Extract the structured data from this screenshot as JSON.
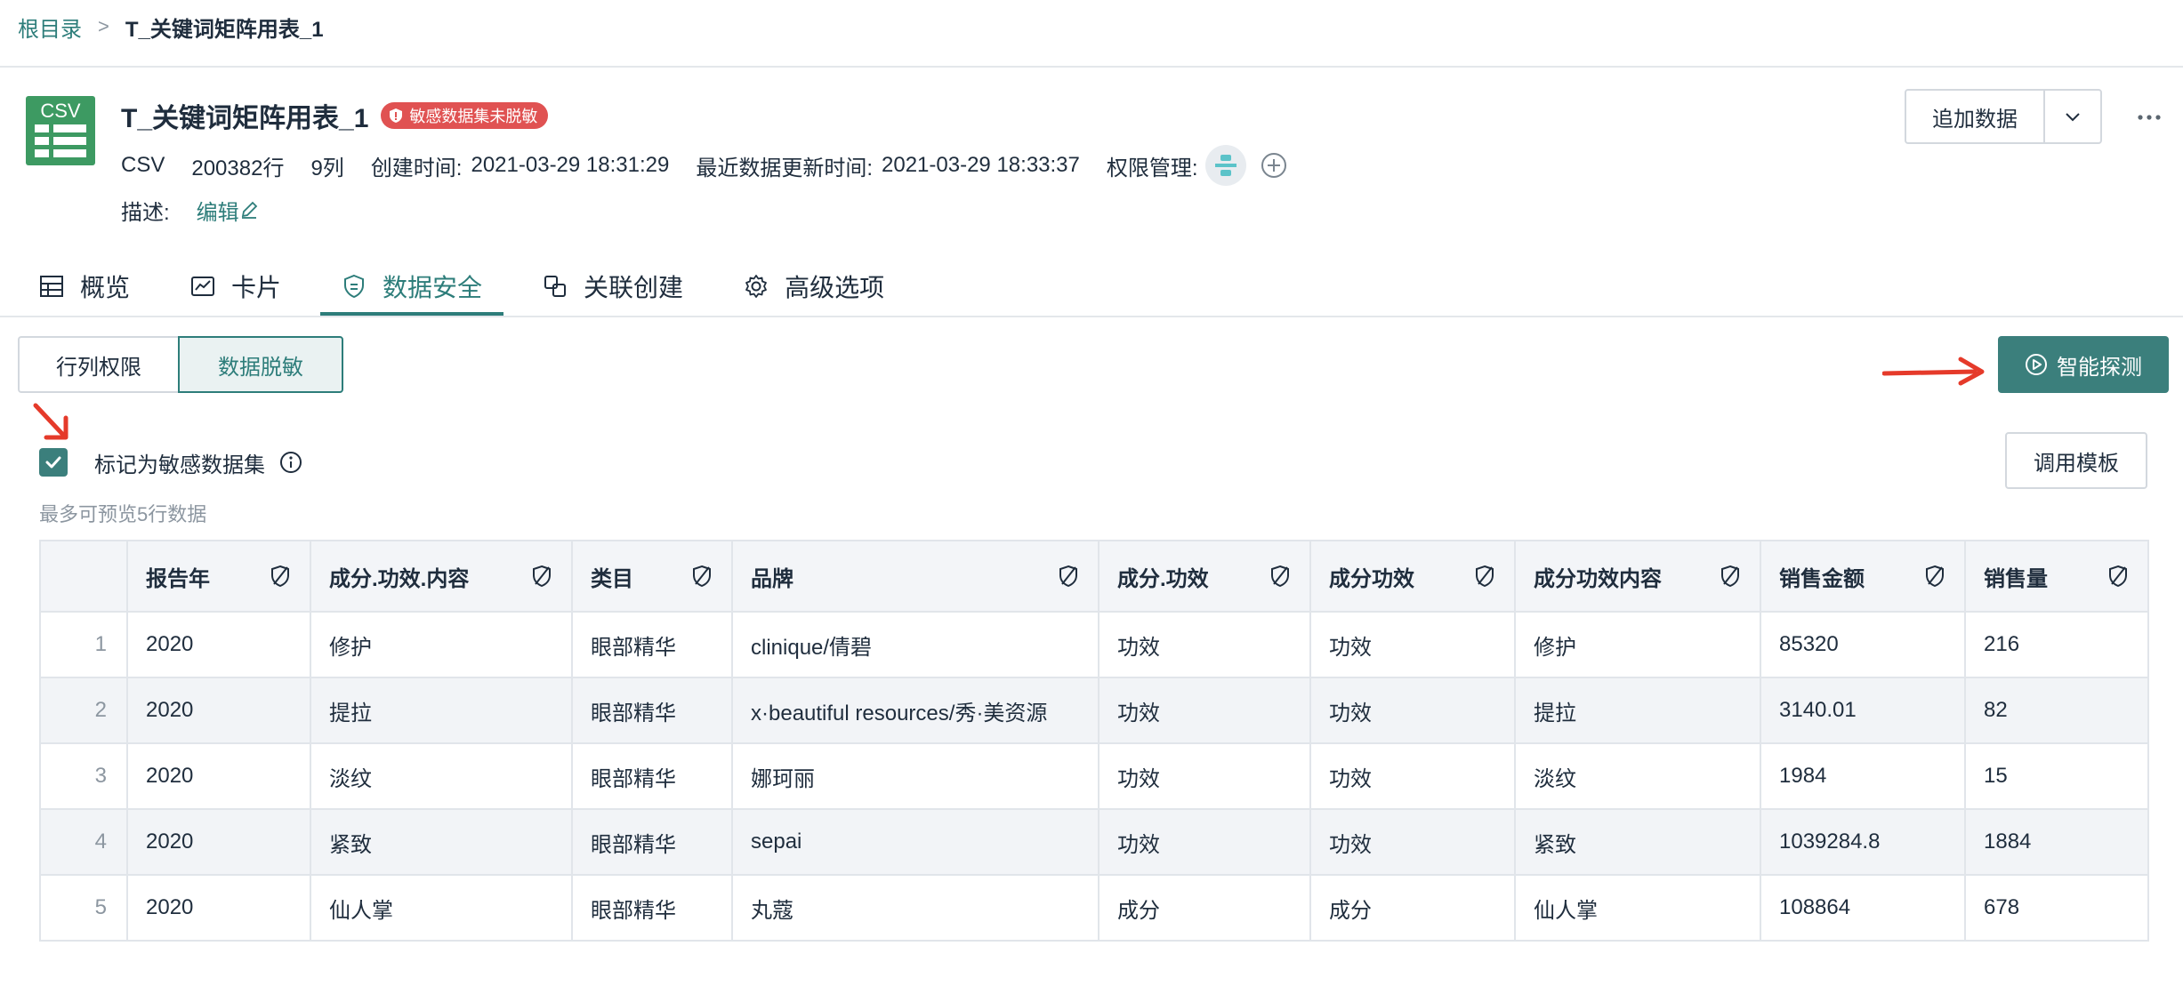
{
  "breadcrumb": {
    "root": "根目录",
    "separator": ">",
    "current": "T_关键词矩阵用表_1"
  },
  "dataset": {
    "icon_text": "CSV",
    "title": "T_关键词矩阵用表_1",
    "badge": "敏感数据集未脱敏",
    "type": "CSV",
    "rows": "200382行",
    "cols": "9列",
    "created_label": "创建时间:",
    "created_value": "2021-03-29 18:31:29",
    "updated_label": "最近数据更新时间:",
    "updated_value": "2021-03-29 18:33:37",
    "perm_label": "权限管理:",
    "desc_label": "描述:",
    "desc_edit": "编辑"
  },
  "actions": {
    "append": "追加数据",
    "more": "···"
  },
  "tabs": [
    {
      "label": "概览",
      "icon": "table-icon"
    },
    {
      "label": "卡片",
      "icon": "chart-card-icon"
    },
    {
      "label": "数据安全",
      "icon": "shield-icon",
      "active": true
    },
    {
      "label": "关联创建",
      "icon": "link-icon"
    },
    {
      "label": "高级选项",
      "icon": "gear-icon"
    }
  ],
  "subtabs": {
    "row_col": "行列权限",
    "mask": "数据脱敏"
  },
  "detect_button": "智能探测",
  "sensitive": {
    "label": "标记为敏感数据集",
    "checked": true
  },
  "template_button": "调用模板",
  "preview_note": "最多可预览5行数据",
  "table": {
    "headers": [
      "报告年",
      "成分.功效.内容",
      "类目",
      "品牌",
      "成分.功效",
      "成分功效",
      "成分功效内容",
      "销售金额",
      "销售量"
    ],
    "rows": [
      [
        "1",
        "2020",
        "修护",
        "眼部精华",
        "clinique/倩碧",
        "功效",
        "功效",
        "修护",
        "85320",
        "216"
      ],
      [
        "2",
        "2020",
        "提拉",
        "眼部精华",
        "x·beautiful resources/秀·美资源",
        "功效",
        "功效",
        "提拉",
        "3140.01",
        "82"
      ],
      [
        "3",
        "2020",
        "淡纹",
        "眼部精华",
        "娜珂丽",
        "功效",
        "功效",
        "淡纹",
        "1984",
        "15"
      ],
      [
        "4",
        "2020",
        "紧致",
        "眼部精华",
        "sepai",
        "功效",
        "功效",
        "紧致",
        "1039284.8",
        "1884"
      ],
      [
        "5",
        "2020",
        "仙人掌",
        "眼部精华",
        "丸蔻",
        "成分",
        "成分",
        "仙人掌",
        "108864",
        "678"
      ]
    ]
  },
  "colors": {
    "accent": "#2d7d7a",
    "button": "#3b7f7c",
    "badge": "#e05252",
    "annotation_arrow": "#e53a2a"
  }
}
